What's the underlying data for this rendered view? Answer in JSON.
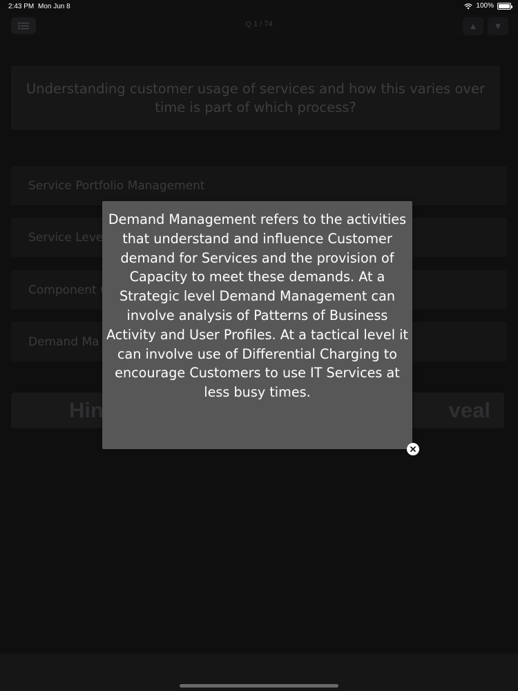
{
  "status_bar": {
    "time": "2:43 PM",
    "date": "Mon Jun 8",
    "battery": "100%",
    "wifi_icon": "wifi-icon",
    "battery_icon": "battery-icon"
  },
  "nav": {
    "title": "Q 1 / 74",
    "menu_icon": "list-icon",
    "up_icon": "triangle-up-icon",
    "down_icon": "triangle-down-icon",
    "up_glyph": "▲",
    "down_glyph": "▼"
  },
  "question": {
    "text": "Understanding customer usage of services and how this varies over time is part of which process?"
  },
  "answers": [
    {
      "label": "Service Portfolio Management"
    },
    {
      "label": "Service Level"
    },
    {
      "label": "Component C"
    },
    {
      "label": "Demand Ma"
    }
  ],
  "actions": {
    "hint_label": "Hin",
    "reveal_label": "veal"
  },
  "popup": {
    "text": "Demand Management refers to the activities that understand and influence Customer demand for Services and the provision of Capacity to meet these demands. At a Strategic level Demand Management can involve analysis of Patterns of Business Activity and User Profiles. At a tactical level it can involve use of Differential Charging to encourage Customers to use IT Services at less busy times.",
    "close_icon": "close-icon"
  },
  "colors": {
    "background": "#0f0f10",
    "popup_background": "#575757",
    "popup_text": "#ffffff"
  }
}
